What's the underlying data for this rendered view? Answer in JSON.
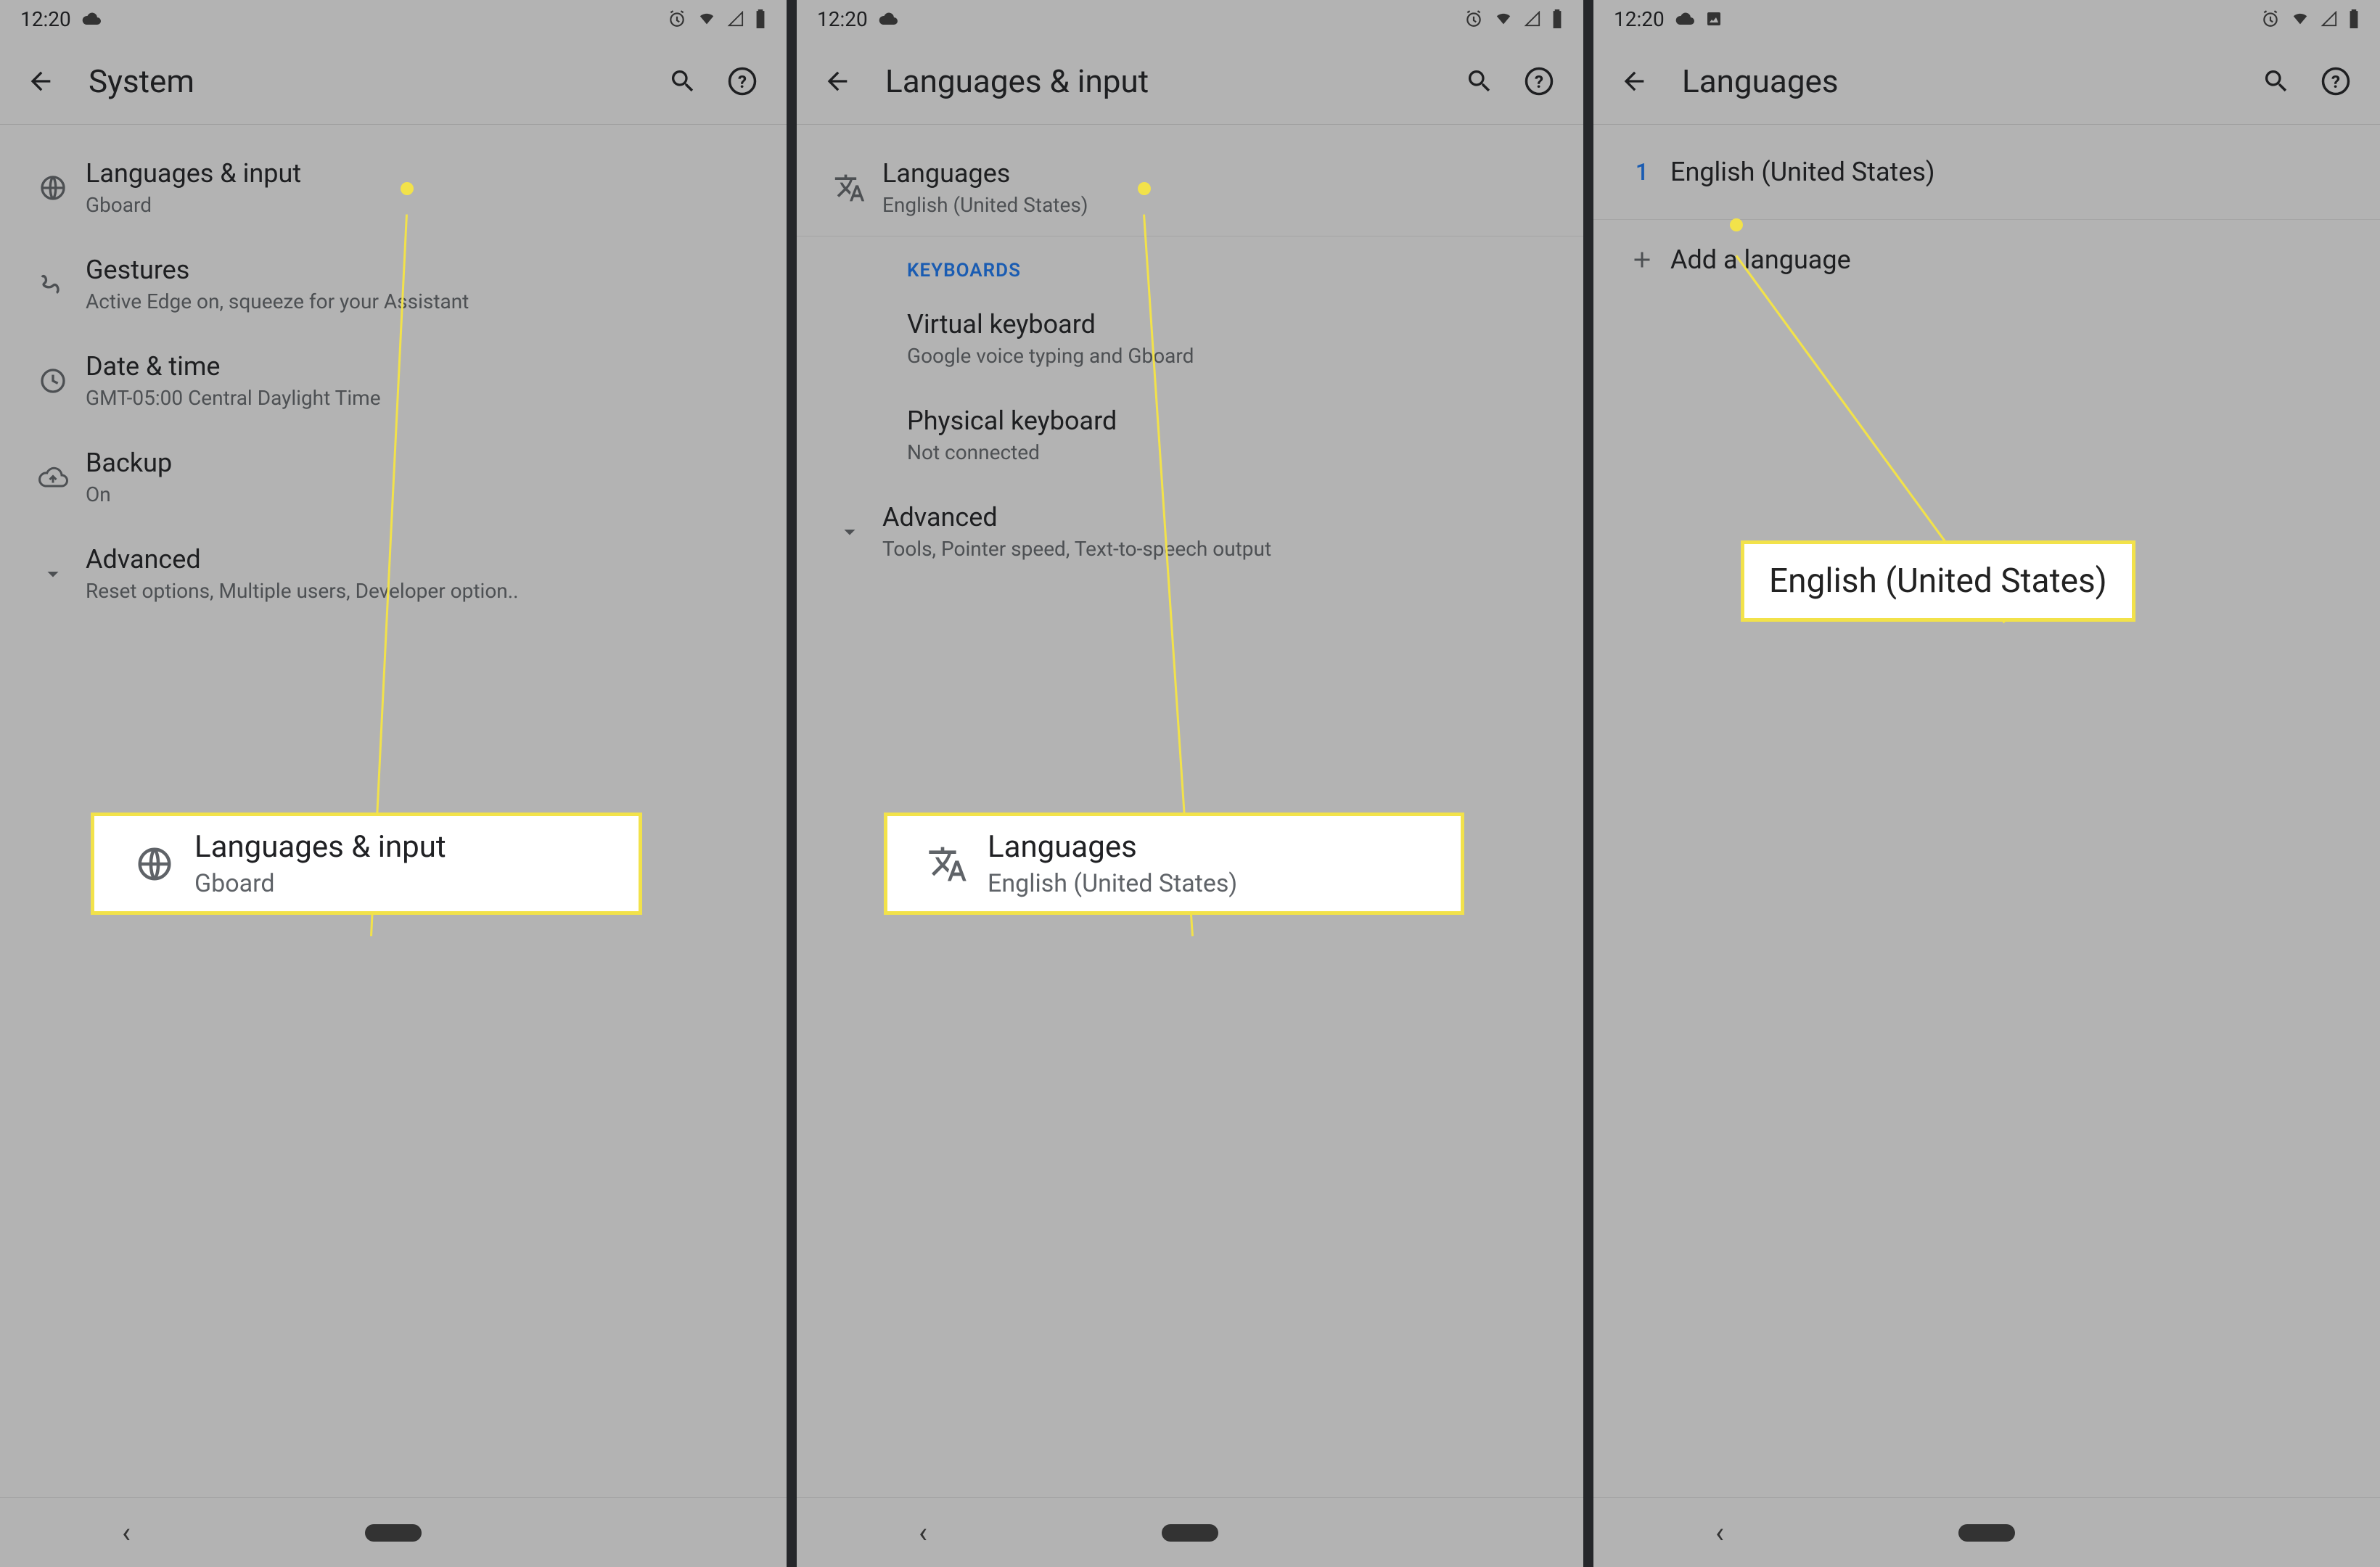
{
  "status": {
    "time": "12:20",
    "cloud": "☁",
    "picture": "🖼"
  },
  "screen1": {
    "title": "System",
    "items": [
      {
        "primary": "Languages & input",
        "secondary": "Gboard"
      },
      {
        "primary": "Gestures",
        "secondary": "Active Edge on, squeeze for your Assistant"
      },
      {
        "primary": "Date & time",
        "secondary": "GMT-05:00 Central Daylight Time"
      },
      {
        "primary": "Backup",
        "secondary": "On"
      },
      {
        "primary": "Advanced",
        "secondary": "Reset options, Multiple users, Developer option.."
      }
    ],
    "callout": {
      "primary": "Languages & input",
      "secondary": "Gboard"
    }
  },
  "screen2": {
    "title": "Languages & input",
    "languages": {
      "primary": "Languages",
      "secondary": "English (United States)"
    },
    "keyboards_label": "KEYBOARDS",
    "virtual": {
      "primary": "Virtual keyboard",
      "secondary": "Google voice typing and Gboard"
    },
    "physical": {
      "primary": "Physical keyboard",
      "secondary": "Not connected"
    },
    "advanced": {
      "primary": "Advanced",
      "secondary": "Tools, Pointer speed, Text-to-speech output"
    },
    "callout": {
      "primary": "Languages",
      "secondary": "English (United States)"
    }
  },
  "screen3": {
    "title": "Languages",
    "num": "1",
    "lang": "English (United States)",
    "add": "Add a language",
    "callout": "English (United States)"
  }
}
